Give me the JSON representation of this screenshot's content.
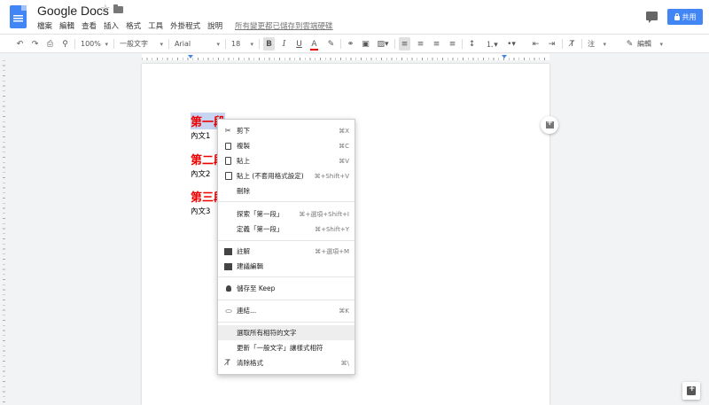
{
  "header": {
    "title": "Google Docs",
    "save_status": "所有變更都已儲存到雲端硬碟",
    "share_label": "共用",
    "menu": [
      "檔案",
      "編輯",
      "查看",
      "插入",
      "格式",
      "工具",
      "外掛程式",
      "說明"
    ]
  },
  "toolbar": {
    "zoom": "100%",
    "style": "一般文字",
    "font": "Arial",
    "size": "18",
    "bold": "B",
    "italic": "I",
    "underline": "U",
    "text_color": "A",
    "list_label": "注",
    "mode": "編輯"
  },
  "document": {
    "heading1": "第一段",
    "body1": "內文1",
    "heading2": "第二段",
    "body2": "內文2",
    "heading3": "第三段",
    "body3": "內文3",
    "heading_color": "#e00000"
  },
  "context_menu": {
    "cut": {
      "label": "剪下",
      "shortcut": "⌘X"
    },
    "copy": {
      "label": "複製",
      "shortcut": "⌘C"
    },
    "paste": {
      "label": "貼上",
      "shortcut": "⌘V"
    },
    "paste_plain": {
      "label": "貼上 (不套用格式設定)",
      "shortcut": "⌘+Shift+V"
    },
    "delete": {
      "label": "刪除"
    },
    "search": {
      "label": "探索「第一段」",
      "shortcut": "⌘+選項+Shift+I"
    },
    "define": {
      "label": "定義「第一段」",
      "shortcut": "⌘+Shift+Y"
    },
    "comment": {
      "label": "註解",
      "shortcut": "⌘+選項+M"
    },
    "suggest": {
      "label": "建議編輯"
    },
    "keep": {
      "label": "儲存至 Keep"
    },
    "link": {
      "label": "連結...",
      "shortcut": "⌘K"
    },
    "select_all_matching": {
      "label": "選取所有相符的文字"
    },
    "update_style": {
      "label": "更新「一般文字」讓樣式相符"
    },
    "clear_format": {
      "label": "清除格式",
      "shortcut": "⌘\\"
    }
  }
}
